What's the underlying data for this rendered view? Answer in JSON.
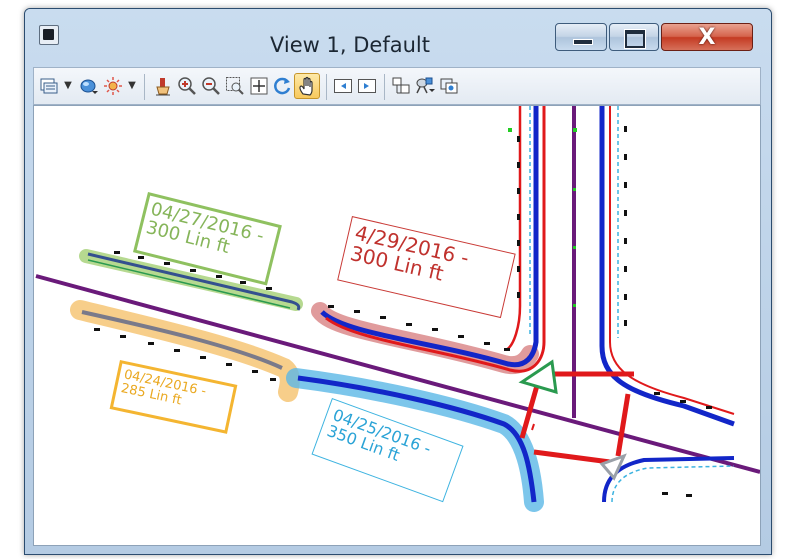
{
  "window": {
    "title": "View 1, Default",
    "buttons": {
      "minimize": "—",
      "maximize": "□",
      "close": "X"
    }
  },
  "toolbar": {
    "icons": [
      "view-attributes-icon",
      "dropdown-arrow-icon",
      "display-style-icon",
      "lighting-icon",
      "dropdown-arrow-icon",
      "update-view-icon",
      "zoom-in-icon",
      "zoom-out-icon",
      "window-area-icon",
      "fit-view-icon",
      "rotate-view-icon",
      "pan-view-icon",
      "previous-view-icon",
      "next-view-icon",
      "view-navigation-icon",
      "camera-icon",
      "copy-view-icon"
    ],
    "active": "pan-view-icon"
  },
  "annotations": {
    "green": {
      "line1": "04/27/2016 -",
      "line2": "300 Lin ft",
      "color": "#86b55a"
    },
    "red": {
      "line1": "4/29/2016 -",
      "line2": "300 Lin ft",
      "color": "#c0322e"
    },
    "orange": {
      "line1": "04/24/2016 -",
      "line2": "285 Lin ft",
      "color": "#eaa922"
    },
    "cyan": {
      "line1": "04/25/2016 -",
      "line2": "350 Lin ft",
      "color": "#2aa3d6"
    }
  },
  "colors": {
    "road_centerline": "#6a1a7a",
    "curb_blue": "#1226c8",
    "curb_red": "#e0191b",
    "highlight_green": "#9dcc6b",
    "highlight_red": "#c6494a",
    "highlight_orange": "#f6c576",
    "highlight_cyan": "#5bb8e6"
  }
}
